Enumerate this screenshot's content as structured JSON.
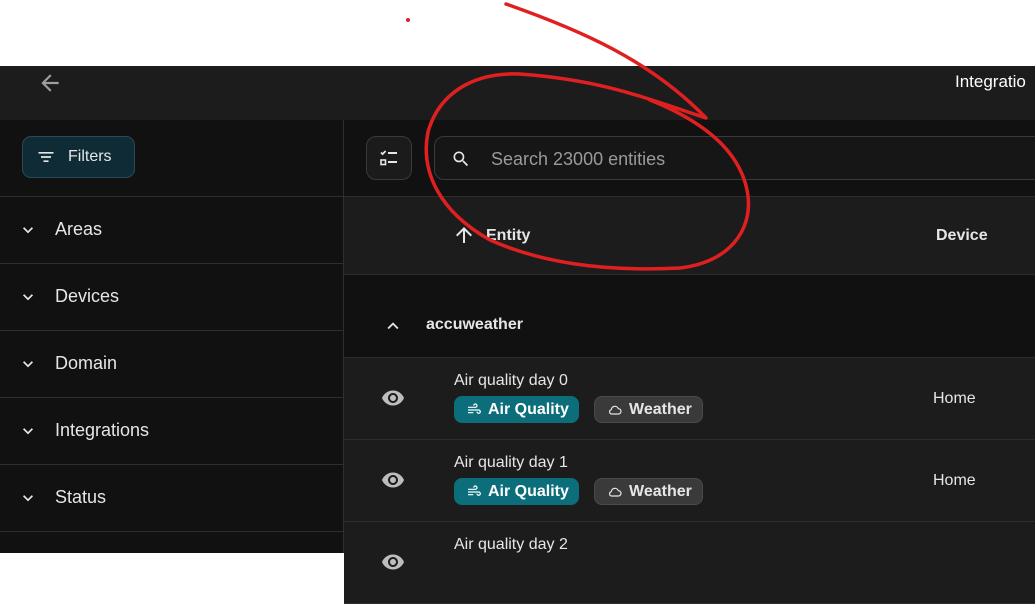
{
  "header": {
    "title": "Integratio",
    "back_icon": "arrow-left-icon"
  },
  "sidebar": {
    "filters_label": "Filters",
    "sections": [
      {
        "label": "Areas"
      },
      {
        "label": "Devices"
      },
      {
        "label": "Domain"
      },
      {
        "label": "Integrations"
      },
      {
        "label": "Status"
      }
    ]
  },
  "search": {
    "placeholder": "Search 23000 entities",
    "value": ""
  },
  "table": {
    "columns": {
      "entity": "Entity",
      "device": "Device"
    },
    "sort": "ascending",
    "group": {
      "name": "accuweather"
    },
    "rows": [
      {
        "name": "Air quality day 0",
        "chip1": "Air Quality",
        "chip2": "Weather",
        "device": "Home"
      },
      {
        "name": "Air quality day 1",
        "chip1": "Air Quality",
        "chip2": "Weather",
        "device": "Home"
      },
      {
        "name": "Air quality day 2"
      }
    ]
  },
  "colors": {
    "accent": "#0c6e7a",
    "annotation": "#e02020",
    "background": "#111111",
    "header": "#1c1c1c"
  }
}
